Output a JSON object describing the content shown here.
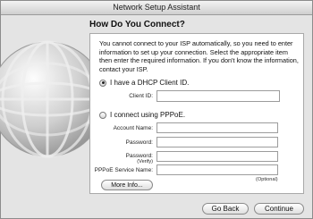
{
  "window": {
    "title": "Network Setup Assistant"
  },
  "page": {
    "heading": "How Do You Connect?",
    "intro": "You cannot connect to your ISP automatically, so you need to enter information to set up your connection. Select the appropriate item then enter the required information. If you don't know the information, contact your ISP."
  },
  "options": {
    "dhcp": {
      "label": "I have a DHCP Client ID.",
      "selected": true
    },
    "pppoe": {
      "label": "I connect using PPPoE.",
      "selected": false
    }
  },
  "fields": {
    "client_id": {
      "label": "Client ID:",
      "value": ""
    },
    "account_name": {
      "label": "Account Name:",
      "value": ""
    },
    "password": {
      "label": "Password:",
      "value": ""
    },
    "password_verify": {
      "label": "Password:",
      "sub": "(Verify)",
      "value": ""
    },
    "pppoe_service": {
      "label": "PPPoE Service Name:",
      "value": "",
      "note": "(Optional)"
    }
  },
  "buttons": {
    "more_info": "More Info...",
    "go_back": "Go Back",
    "continue": "Continue"
  }
}
